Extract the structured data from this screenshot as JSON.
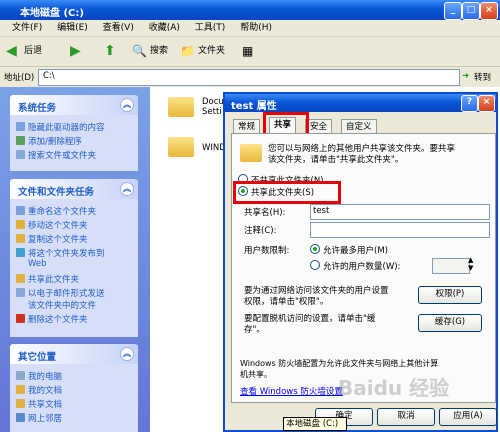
{
  "window": {
    "title": "本地磁盘 (C:)"
  },
  "menu": [
    "文件(F)",
    "编辑(E)",
    "查看(V)",
    "收藏(A)",
    "工具(T)",
    "帮助(H)"
  ],
  "toolbar": {
    "back": "后退",
    "search": "搜索",
    "folders": "文件夹"
  },
  "address": {
    "label": "地址(D)",
    "value": "C:\\",
    "go": "转到"
  },
  "sidebar": {
    "system_tasks": {
      "title": "系统任务",
      "items": [
        "隐藏此驱动器的内容",
        "添加/删除程序",
        "搜索文件或文件夹"
      ]
    },
    "file_tasks": {
      "title": "文件和文件夹任务",
      "items": [
        "重命名这个文件夹",
        "移动这个文件夹",
        "复制这个文件夹",
        "将这个文件夹发布到",
        "Web",
        "共享此文件夹",
        "以电子邮件形式发送",
        "该文件夹中的文件",
        "删除这个文件夹"
      ]
    },
    "other_places": {
      "title": "其它位置",
      "items": [
        "我的电脑",
        "我的文档",
        "共享文档",
        "网上邻居"
      ]
    }
  },
  "content": {
    "folders": [
      "Docu",
      "Setti",
      "WINDO"
    ]
  },
  "dialog": {
    "title": "test 属性",
    "tabs": [
      "常规",
      "共享",
      "安全",
      "自定义"
    ],
    "intro": [
      "您可以与网络上的其他用户共享该文件夹。要共享",
      "该文件夹，请单击\"共享此文件夹\"。"
    ],
    "no_share": "不共享此文件夹(N)",
    "share": "共享此文件夹(S)",
    "share_name_label": "共享名(H):",
    "share_name_value": "test",
    "comment_label": "注释(C):",
    "comment_value": "",
    "user_limit_label": "用户数限制:",
    "max_allowed": "允许最多用户(M)",
    "allow_number": "允许的用户数量(W):",
    "perm_text": [
      "要为通过网络访问该文件夹的用户设置",
      "权限，请单击\"权限\"。"
    ],
    "perm_button": "权限(P)",
    "cache_text": [
      "要配置脱机访问的设置，请单击\"缓",
      "存\"。"
    ],
    "cache_button": "缓存(G)",
    "firewall_text": [
      "Windows 防火墙配置为允许此文件夹与网络上其他计算",
      "机共享。"
    ],
    "firewall_link": "查看 Windows 防火墙设置",
    "ok": "确定",
    "cancel": "取消",
    "apply": "应用(A)"
  },
  "tooltip": "本地磁盘 (C:)",
  "watermark": "Baidu 经验"
}
